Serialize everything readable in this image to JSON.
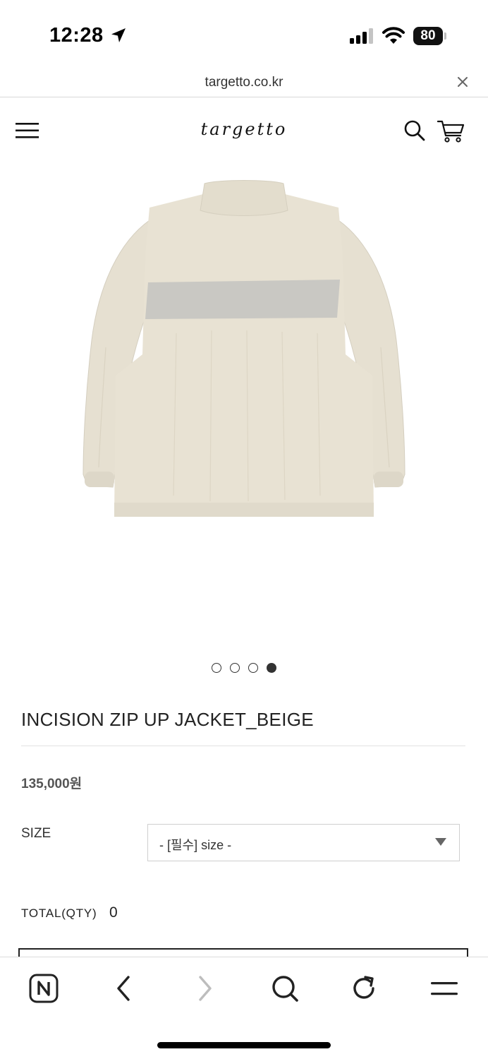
{
  "status_bar": {
    "time": "12:28",
    "battery": "80"
  },
  "browser": {
    "url": "targetto.co.kr"
  },
  "site": {
    "logo": "targetto"
  },
  "gallery": {
    "image_alt": "beige zip up jacket back view",
    "total_slides": 4,
    "active_slide": 4
  },
  "product": {
    "title": "INCISION ZIP UP JACKET_BEIGE",
    "price": "135,000원",
    "size_label": "SIZE",
    "size_select_value": "- [필수] size -",
    "total_label": "TOTAL(QTY)",
    "total_qty": "0"
  },
  "colors": {
    "jacket_body": "#e8e2d3",
    "jacket_stripe": "#c9c8c3",
    "text_dark": "#222222"
  }
}
